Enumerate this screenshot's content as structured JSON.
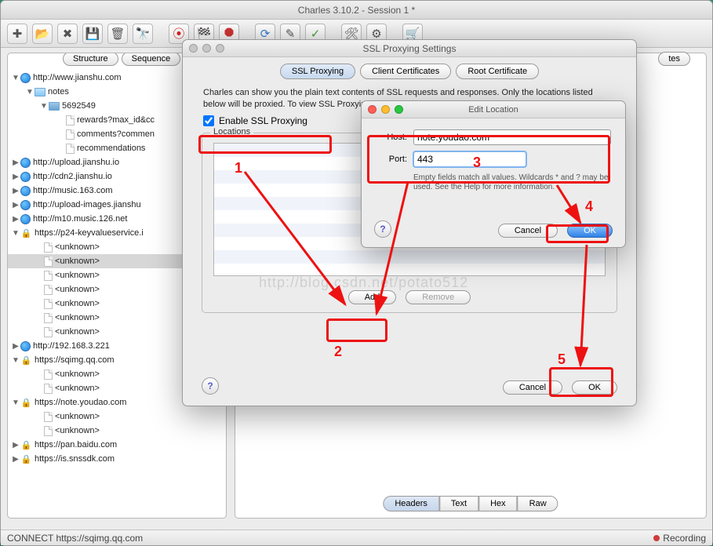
{
  "app_title": "Charles 3.10.2 - Session 1 *",
  "local_tabs": {
    "structure": "Structure",
    "sequence": "Sequence"
  },
  "right_tabs": {
    "notes": "tes"
  },
  "bottom_tabs": {
    "headers": "Headers",
    "text": "Text",
    "hex": "Hex",
    "raw": "Raw"
  },
  "statusbar": {
    "left": "CONNECT https://sqimg.qq.com",
    "right": "Recording"
  },
  "tree": {
    "r0": "http://www.jianshu.com",
    "r1": "notes",
    "r2": "5692549",
    "r3": "rewards?max_id&cc",
    "r4": "comments?commen",
    "r5": "recommendations",
    "r6": "http://upload.jianshu.io",
    "r7": "http://cdn2.jianshu.io",
    "r8": "http://music.163.com",
    "r9": "http://upload-images.jianshu",
    "r10": "http://m10.music.126.net",
    "r11": "https://p24-keyvalueservice.i",
    "r12": "<unknown>",
    "r13": "<unknown>",
    "r14": "<unknown>",
    "r15": "<unknown>",
    "r16": "<unknown>",
    "r17": "<unknown>",
    "r18": "<unknown>",
    "r19": "http://192.168.3.221",
    "r20": "https://sqimg.qq.com",
    "r21": "<unknown>",
    "r22": "<unknown>",
    "r23": "https://note.youdao.com",
    "r24": "<unknown>",
    "r25": "<unknown>",
    "r26": "https://pan.baidu.com",
    "r27": "https://is.snssdk.com"
  },
  "ssl_dialog": {
    "title": "SSL Proxying Settings",
    "tab1": "SSL Proxying",
    "tab2": "Client Certificates",
    "tab3": "Root Certificate",
    "info": "Charles can show you the plain text contents of SSL requests and responses. Only the locations listed below will be proxied. To view SSL Proxying certificates, please press the Help button.",
    "checkbox": "Enable SSL Proxying",
    "legend": "Locations",
    "add": "Add",
    "remove": "Remove",
    "cancel": "Cancel",
    "ok": "OK"
  },
  "edit_dialog": {
    "title": "Edit Location",
    "host_label": "Host:",
    "host_value": "note.youdao.com",
    "port_label": "Port:",
    "port_value": "443",
    "hint": "Empty fields match all values. Wildcards * and ? may be used. See the Help for more information.",
    "cancel": "Cancel",
    "ok": "OK"
  },
  "annot": {
    "n1": "1",
    "n2": "2",
    "n3": "3",
    "n4": "4",
    "n5": "5"
  },
  "watermark": "http://blog.csdn.net/potato512"
}
